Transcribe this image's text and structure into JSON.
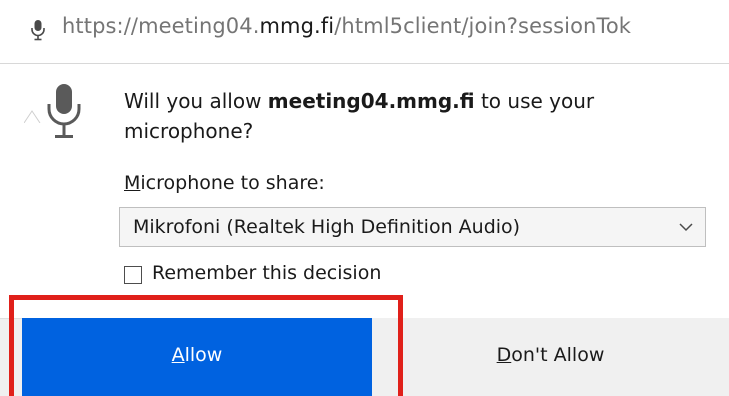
{
  "urlbar": {
    "mic_icon": "microphone-icon",
    "url_prefix": "https://meeting04.",
    "url_host": "mmg.fi",
    "url_suffix": "/html5client/join?sessionTok"
  },
  "prompt": {
    "icon": "microphone-icon",
    "question_start": "Will you allow ",
    "question_host": "meeting04.mmg.fi",
    "question_end": " to use your microphone?",
    "share_label_accel": "M",
    "share_label_rest": "icrophone to share:",
    "selected_device": "Mikrofoni (Realtek High Definition Audio)",
    "dropdown_icon": "chevron-down-icon",
    "remember_label": "Remember this decision",
    "remember_checked": false
  },
  "buttons": {
    "allow_accel": "A",
    "allow_rest": "llow",
    "deny_accel": "D",
    "deny_rest": "on't Allow"
  },
  "colors": {
    "allow_bg": "#0062e0",
    "highlight": "#e0201a"
  }
}
